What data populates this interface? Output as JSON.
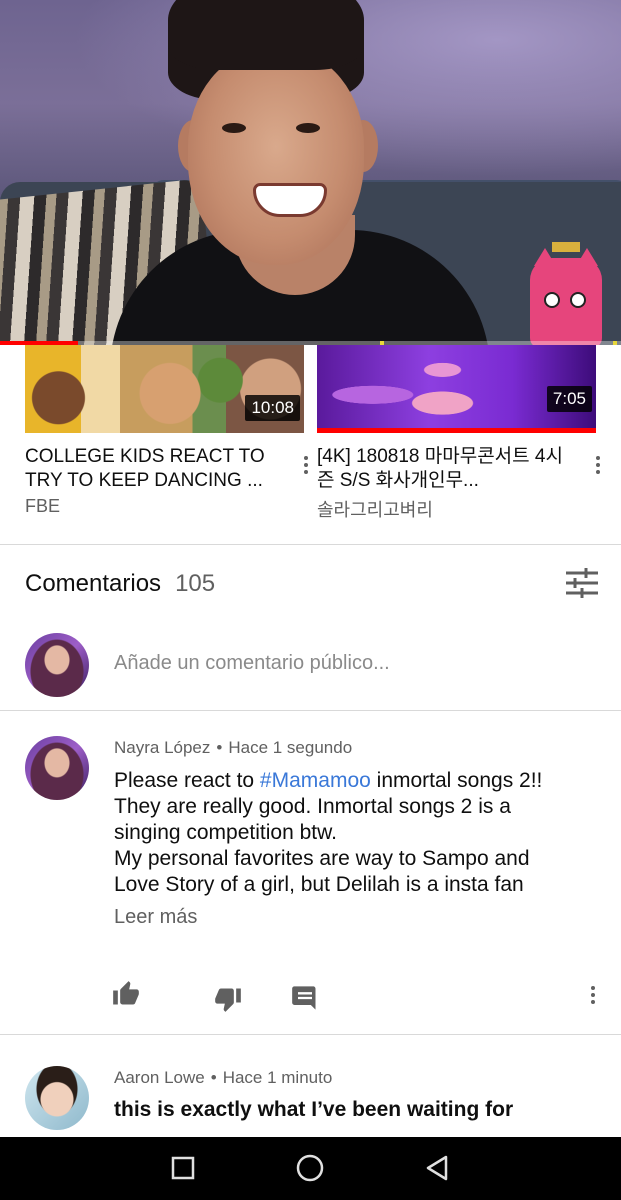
{
  "player": {
    "progress_fraction": 0.125,
    "colors": {
      "progress": "#ff0000",
      "marker": "#e8d83a"
    }
  },
  "related": [
    {
      "title": "COLLEGE KIDS REACT TO TRY TO KEEP DANCING ...",
      "channel": "FBE",
      "duration": "10:08"
    },
    {
      "title": "[4K] 180818 마마무콘서트 4시즌 S/S 화사개인무...",
      "channel": "솔라그리고벼리",
      "duration": "7:05"
    }
  ],
  "comments_section": {
    "title": "Comentarios",
    "count": "105",
    "sort_icon": "sort-filter-icon",
    "add_placeholder": "Añade un comentario público..."
  },
  "comments": [
    {
      "author": "Nayra López",
      "separator": "•",
      "time": "Hace 1 segundo",
      "text_before": "Please react to ",
      "hashtag": "#Mamamoo",
      "text_after": " inmortal songs 2!! They are really good. Inmortal songs 2 is a singing competition btw.",
      "text_line2": "My personal favorites are way to Sampo and Love Story of a girl, but Delilah is a insta fan",
      "read_more": "Leer más",
      "actions": [
        "thumb-up-icon",
        "thumb-down-icon",
        "reply-icon",
        "more-vert-icon"
      ]
    },
    {
      "author": "Aaron Lowe",
      "separator": "•",
      "time": "Hace 1 minuto",
      "text": "this is exactly what I’ve been waiting for"
    }
  ],
  "navbar": {
    "buttons": [
      "recents-square-icon",
      "home-circle-icon",
      "back-triangle-icon"
    ]
  },
  "colors": {
    "link": "#3a78d8",
    "secondary_text": "#606060",
    "accent_red": "#ff0000"
  }
}
